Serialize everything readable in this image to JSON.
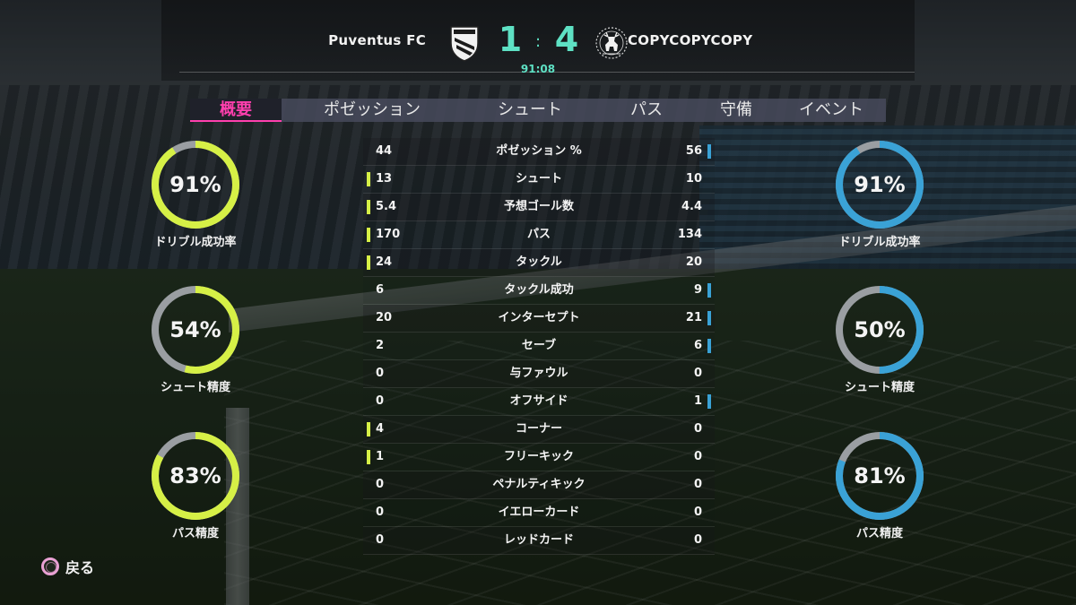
{
  "match": {
    "home_team": "Puventus FC",
    "away_team": "COPYCOPYCOPY",
    "home_score": "1",
    "away_score": "4",
    "score_separator": ":",
    "clock": "91:08"
  },
  "colors": {
    "home_accent": "#d6f046",
    "away_accent": "#3aa2d6",
    "score_accent": "#5ee1c4",
    "tab_active": "#ff3fae",
    "gauge_track": "#9a9ea2"
  },
  "icons": {
    "home_crest": "shield-crest-icon",
    "away_crest": "stag-crest-icon",
    "back_button": "circle-button-icon"
  },
  "tabs": [
    {
      "label": "概要",
      "active": true
    },
    {
      "label": "ポゼッション",
      "active": false
    },
    {
      "label": "シュート",
      "active": false
    },
    {
      "label": "パス",
      "active": false
    },
    {
      "label": "守備",
      "active": false
    },
    {
      "label": "イベント",
      "active": false
    }
  ],
  "gauges": {
    "home": [
      {
        "label": "ドリブル成功率",
        "value": "91%",
        "percent": 91
      },
      {
        "label": "シュート精度",
        "value": "54%",
        "percent": 54
      },
      {
        "label": "パス精度",
        "value": "83%",
        "percent": 83
      }
    ],
    "away": [
      {
        "label": "ドリブル成功率",
        "value": "91%",
        "percent": 91
      },
      {
        "label": "シュート精度",
        "value": "50%",
        "percent": 50
      },
      {
        "label": "パス精度",
        "value": "81%",
        "percent": 81
      }
    ]
  },
  "stats": [
    {
      "label": "ポゼッション %",
      "home": "44",
      "away": "56",
      "leader": "away"
    },
    {
      "label": "シュート",
      "home": "13",
      "away": "10",
      "leader": "home"
    },
    {
      "label": "予想ゴール数",
      "home": "5.4",
      "away": "4.4",
      "leader": "home"
    },
    {
      "label": "パス",
      "home": "170",
      "away": "134",
      "leader": "home"
    },
    {
      "label": "タックル",
      "home": "24",
      "away": "20",
      "leader": "home"
    },
    {
      "label": "タックル成功",
      "home": "6",
      "away": "9",
      "leader": "away"
    },
    {
      "label": "インターセプト",
      "home": "20",
      "away": "21",
      "leader": "away"
    },
    {
      "label": "セーブ",
      "home": "2",
      "away": "6",
      "leader": "away"
    },
    {
      "label": "与ファウル",
      "home": "0",
      "away": "0",
      "leader": "none"
    },
    {
      "label": "オフサイド",
      "home": "0",
      "away": "1",
      "leader": "away"
    },
    {
      "label": "コーナー",
      "home": "4",
      "away": "0",
      "leader": "home"
    },
    {
      "label": "フリーキック",
      "home": "1",
      "away": "0",
      "leader": "home"
    },
    {
      "label": "ペナルティキック",
      "home": "0",
      "away": "0",
      "leader": "none"
    },
    {
      "label": "イエローカード",
      "home": "0",
      "away": "0",
      "leader": "none"
    },
    {
      "label": "レッドカード",
      "home": "0",
      "away": "0",
      "leader": "none"
    }
  ],
  "footer": {
    "back_label": "戻る"
  }
}
